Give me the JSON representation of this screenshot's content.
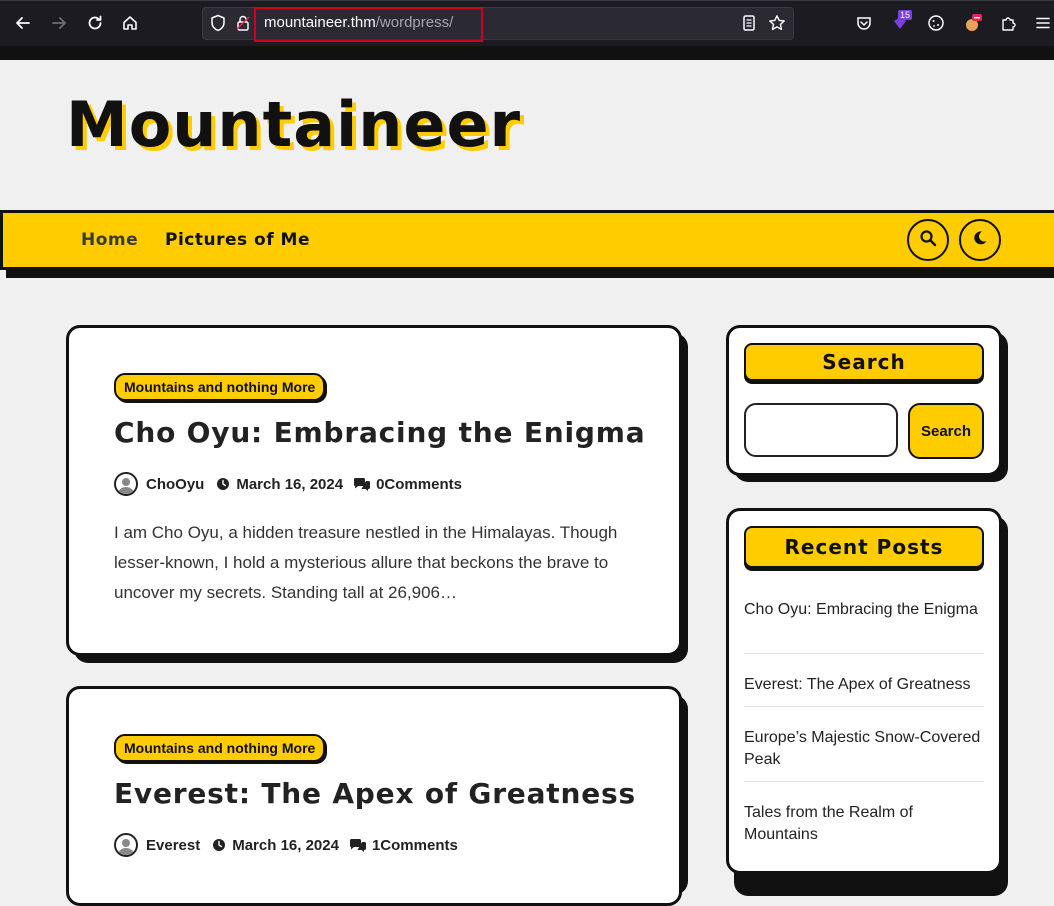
{
  "browser": {
    "url_host": "mountaineer.thm",
    "url_path": "/wordpress/",
    "extension_badge_count": "15"
  },
  "site": {
    "title": "Mountaineer",
    "nav": {
      "home": "Home",
      "pictures": "Pictures of Me"
    },
    "accent_color": "#ffcc00"
  },
  "posts": [
    {
      "category": "Mountains and nothing More",
      "title": "Cho Oyu: Embracing the Enigma",
      "author": "ChoOyu",
      "date": "March 16, 2024",
      "comments": "0Comments",
      "excerpt": "I am Cho Oyu, a hidden treasure nestled in the Himalayas. Though lesser-known, I hold a mysterious allure that beckons the brave to uncover my secrets. Standing tall at 26,906…"
    },
    {
      "category": "Mountains and nothing More",
      "title": "Everest: The Apex of Greatness",
      "author": "Everest",
      "date": "March 16, 2024",
      "comments": "1Comments"
    }
  ],
  "sidebar": {
    "search": {
      "title": "Search",
      "button": "Search",
      "value": ""
    },
    "recent": {
      "title": "Recent Posts",
      "items": [
        "Cho Oyu: Embracing the Enigma",
        "Everest: The Apex of Greatness",
        "Europe’s Majestic Snow-Covered Peak",
        "Tales from the Realm of Mountains"
      ]
    }
  }
}
